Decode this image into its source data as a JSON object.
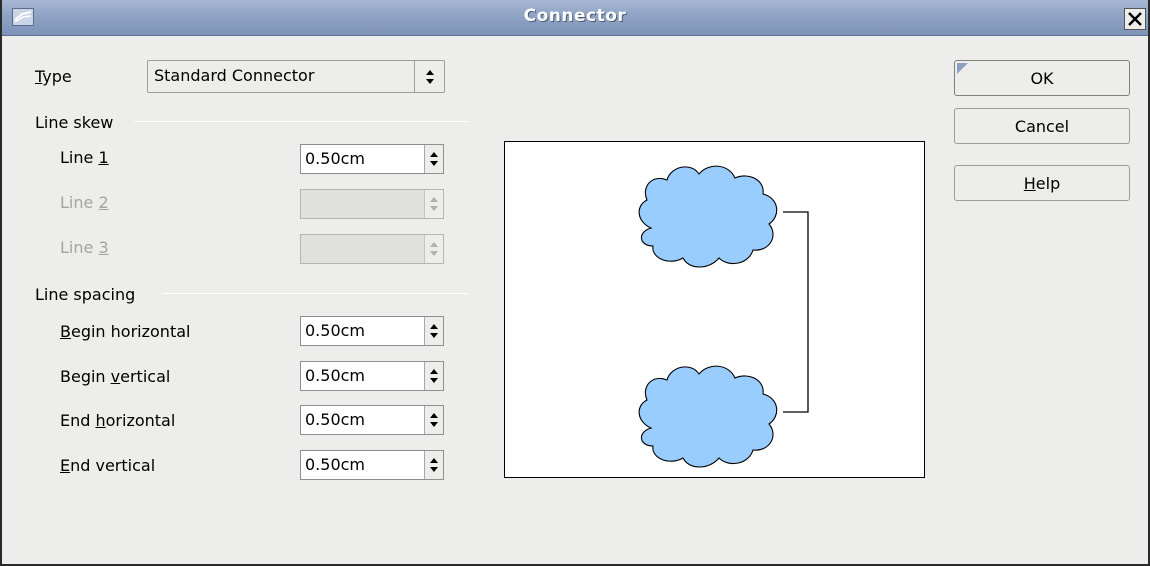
{
  "window": {
    "title": "Connector"
  },
  "type_field": {
    "label_mnemonic": "T",
    "label_rest": "ype",
    "value": "Standard Connector"
  },
  "line_skew": {
    "heading": "Line skew",
    "rows": [
      {
        "label_before": "Line ",
        "mnemonic": "1",
        "value": "0.50cm",
        "enabled": true
      },
      {
        "label_before": "Line ",
        "mnemonic": "2",
        "value": "",
        "enabled": false
      },
      {
        "label_before": "Line ",
        "mnemonic": "3",
        "value": "",
        "enabled": false
      }
    ]
  },
  "line_spacing": {
    "heading": "Line spacing",
    "rows": [
      {
        "label_before": "",
        "mnemonic": "B",
        "label_after": "egin horizontal",
        "value": "0.50cm"
      },
      {
        "label_before": "Begin ",
        "mnemonic": "v",
        "label_after": "ertical",
        "value": "0.50cm"
      },
      {
        "label_before": "End ",
        "mnemonic": "h",
        "label_after": "orizontal",
        "value": "0.50cm"
      },
      {
        "label_before": "",
        "mnemonic": "E",
        "label_after": "nd vertical",
        "value": "0.50cm"
      }
    ]
  },
  "buttons": {
    "ok": "OK",
    "cancel": "Cancel",
    "help_mnemonic": "H",
    "help_rest": "elp"
  },
  "colors": {
    "cloud_fill": "#99ccff",
    "titlebar": "#8fa3c4"
  }
}
